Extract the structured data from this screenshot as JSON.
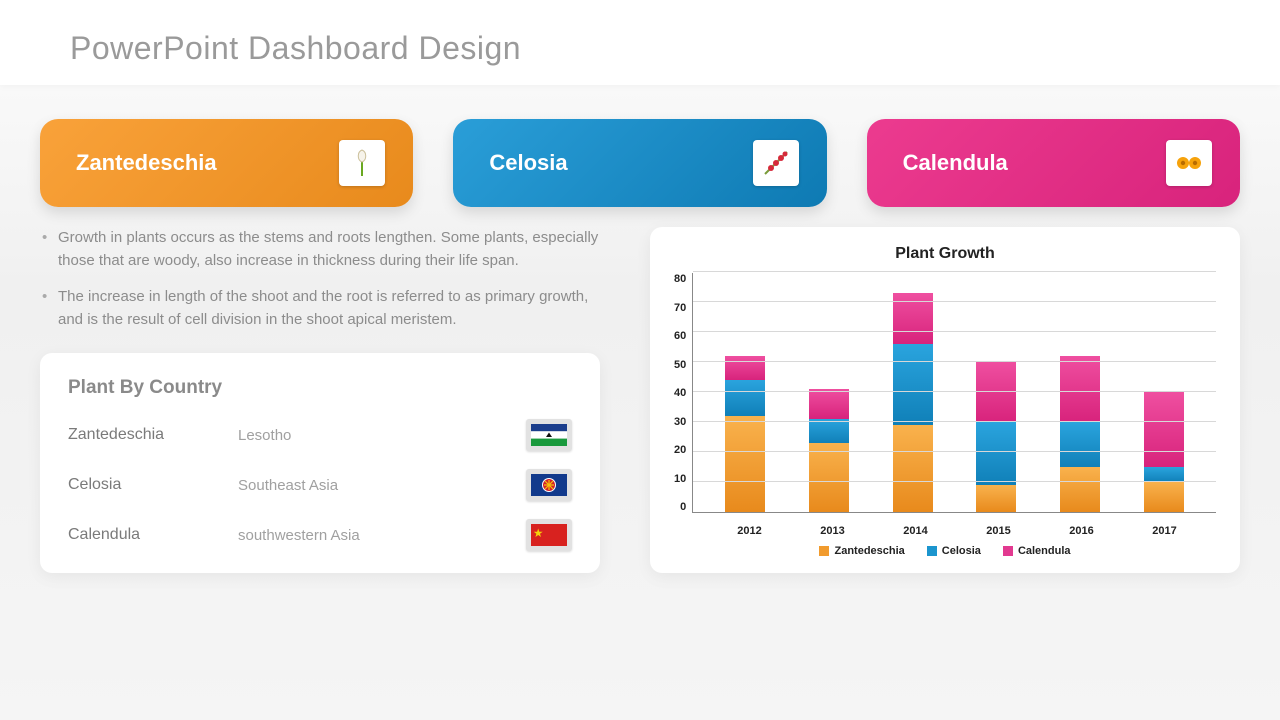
{
  "title": "PowerPoint Dashboard Design",
  "cards": [
    {
      "label": "Zantedeschia",
      "color": "orange",
      "icon": "calla-lily-icon"
    },
    {
      "label": "Celosia",
      "color": "blue",
      "icon": "celosia-icon"
    },
    {
      "label": "Calendula",
      "color": "pink",
      "icon": "calendula-icon"
    }
  ],
  "bullets": [
    "Growth in plants occurs as the stems and roots lengthen. Some plants, especially those that are woody, also increase in thickness during their life span.",
    "The increase in length of the shoot and the root is referred to as primary growth, and is the result of cell division in the shoot apical meristem."
  ],
  "country_panel": {
    "title": "Plant By Country",
    "rows": [
      {
        "plant": "Zantedeschia",
        "country": "Lesotho",
        "flag": "lesotho"
      },
      {
        "plant": "Celosia",
        "country": "Southeast Asia",
        "flag": "asean"
      },
      {
        "plant": "Calendula",
        "country": "southwestern Asia",
        "flag": "china"
      }
    ]
  },
  "chart_data": {
    "type": "bar",
    "stacked": true,
    "title": "Plant Growth",
    "xlabel": "",
    "ylabel": "",
    "ylim": [
      0,
      80
    ],
    "yticks": [
      0,
      10,
      20,
      30,
      40,
      50,
      60,
      70,
      80
    ],
    "categories": [
      "2012",
      "2013",
      "2014",
      "2015",
      "2016",
      "2017"
    ],
    "series": [
      {
        "name": "Zantedeschia",
        "color": "#f19b2e",
        "values": [
          32,
          23,
          29,
          9,
          15,
          10
        ]
      },
      {
        "name": "Celosia",
        "color": "#1b95ce",
        "values": [
          12,
          8,
          27,
          21,
          15,
          5
        ]
      },
      {
        "name": "Calendula",
        "color": "#e23990",
        "values": [
          8,
          10,
          17,
          20,
          22,
          25
        ]
      }
    ],
    "legend_position": "bottom"
  },
  "colors": {
    "orange": "#f19b2e",
    "blue": "#1b95ce",
    "pink": "#e23990"
  }
}
